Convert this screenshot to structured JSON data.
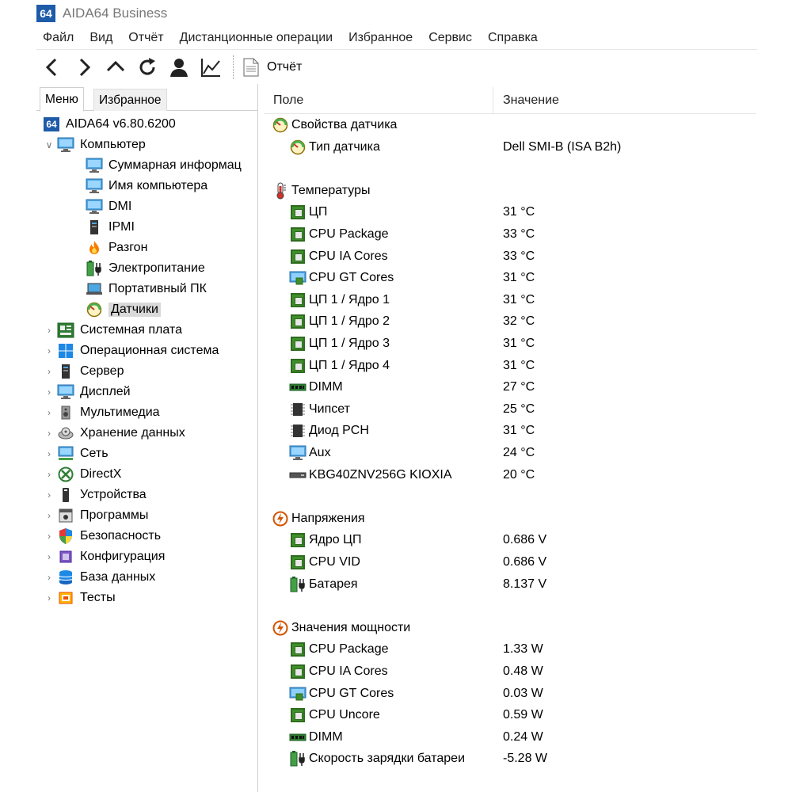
{
  "app": {
    "icon_text": "64",
    "title": "AIDA64 Business"
  },
  "menubar": [
    "Файл",
    "Вид",
    "Отчёт",
    "Дистанционные операции",
    "Избранное",
    "Сервис",
    "Справка"
  ],
  "toolbar": {
    "buttons": [
      "back-icon",
      "forward-icon",
      "up-icon",
      "refresh-icon",
      "user-icon",
      "chart-icon"
    ],
    "report_label": "Отчёт"
  },
  "tabs": {
    "menu": "Меню",
    "favorites": "Избранное"
  },
  "tree": {
    "root": "AIDA64 v6.80.6200",
    "computer": {
      "label": "Компьютер",
      "children": [
        "Суммарная информац",
        "Имя компьютера",
        "DMI",
        "IPMI",
        "Разгон",
        "Электропитание",
        "Портативный ПК",
        "Датчики"
      ]
    },
    "top_items": [
      "Системная плата",
      "Операционная система",
      "Сервер",
      "Дисплей",
      "Мультимедиа",
      "Хранение данных",
      "Сеть",
      "DirectX",
      "Устройства",
      "Программы",
      "Безопасность",
      "Конфигурация",
      "База данных",
      "Тесты"
    ]
  },
  "columns": {
    "field": "Поле",
    "value": "Значение"
  },
  "sections": [
    {
      "title": "Свойства датчика",
      "icon": "sensor-icon",
      "rows": [
        {
          "field": "Тип датчика",
          "value": "Dell SMI-B  (ISA B2h)",
          "icon": "sensor-icon"
        }
      ]
    },
    {
      "title": "Температуры",
      "icon": "thermometer-icon",
      "rows": [
        {
          "field": "ЦП",
          "value": "31 °C",
          "icon": "cpu-chip-icon"
        },
        {
          "field": "CPU Package",
          "value": "33 °C",
          "icon": "cpu-chip-icon"
        },
        {
          "field": "CPU IA Cores",
          "value": "33 °C",
          "icon": "cpu-chip-icon"
        },
        {
          "field": "CPU GT Cores",
          "value": "31 °C",
          "icon": "gpu-icon"
        },
        {
          "field": "ЦП 1 / Ядро 1",
          "value": "31 °C",
          "icon": "cpu-chip-icon"
        },
        {
          "field": "ЦП 1 / Ядро 2",
          "value": "32 °C",
          "icon": "cpu-chip-icon"
        },
        {
          "field": "ЦП 1 / Ядро 3",
          "value": "31 °C",
          "icon": "cpu-chip-icon"
        },
        {
          "field": "ЦП 1 / Ядро 4",
          "value": "31 °C",
          "icon": "cpu-chip-icon"
        },
        {
          "field": "DIMM",
          "value": "27 °C",
          "icon": "dimm-icon"
        },
        {
          "field": "Чипсет",
          "value": "25 °C",
          "icon": "chipset-icon"
        },
        {
          "field": "Диод PCH",
          "value": "31 °C",
          "icon": "chipset-icon"
        },
        {
          "field": "Aux",
          "value": "24 °C",
          "icon": "monitor-icon"
        },
        {
          "field": "KBG40ZNV256G KIOXIA",
          "value": "20 °C",
          "icon": "drive-icon"
        }
      ]
    },
    {
      "title": "Напряжения",
      "icon": "power-icon",
      "rows": [
        {
          "field": "Ядро ЦП",
          "value": "0.686 V",
          "icon": "cpu-chip-icon"
        },
        {
          "field": "CPU VID",
          "value": "0.686 V",
          "icon": "cpu-chip-icon"
        },
        {
          "field": "Батарея",
          "value": "8.137 V",
          "icon": "battery-icon"
        }
      ]
    },
    {
      "title": "Значения мощности",
      "icon": "power-icon",
      "rows": [
        {
          "field": "CPU Package",
          "value": "1.33 W",
          "icon": "cpu-chip-icon"
        },
        {
          "field": "CPU IA Cores",
          "value": "0.48 W",
          "icon": "cpu-chip-icon"
        },
        {
          "field": "CPU GT Cores",
          "value": "0.03 W",
          "icon": "gpu-icon"
        },
        {
          "field": "CPU Uncore",
          "value": "0.59 W",
          "icon": "cpu-chip-icon"
        },
        {
          "field": "DIMM",
          "value": "0.24 W",
          "icon": "dimm-icon"
        },
        {
          "field": "Скорость зарядки батареи",
          "value": "-5.28 W",
          "icon": "battery-icon"
        }
      ]
    }
  ]
}
